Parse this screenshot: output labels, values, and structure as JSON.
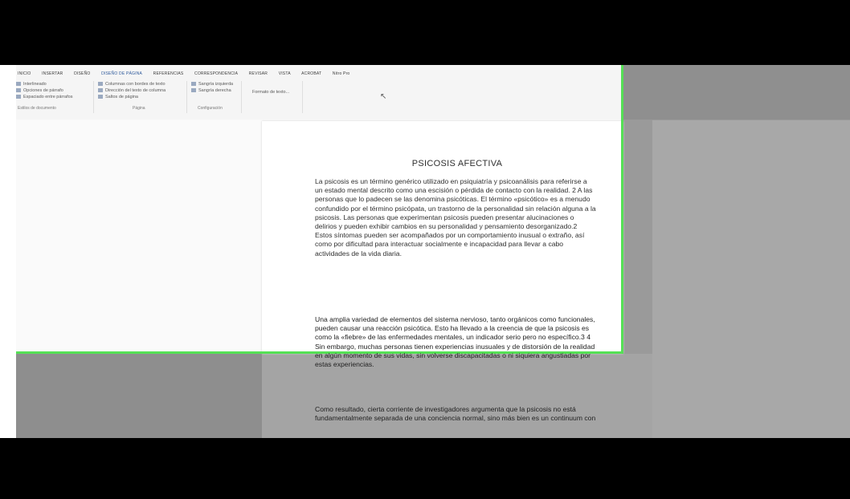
{
  "ribbon": {
    "tabs": [
      "INICIO",
      "INSERTAR",
      "DISEÑO",
      "DISEÑO DE PÁGINA",
      "REFERENCIAS",
      "CORRESPONDENCIA",
      "REVISAR",
      "VISTA",
      "ACROBAT",
      "Nitro Pro"
    ],
    "groups": {
      "g1": {
        "items": [
          "Interlineado",
          "Opciones de párrafo",
          "Espaciado entre párrafos"
        ],
        "label": "Estilos de documento"
      },
      "g2": {
        "items": [
          "Columnas con bordes de texto",
          "Dirección del texto de columna",
          "Saltos de página"
        ],
        "label": "Página"
      },
      "g3": {
        "items": [
          "Sangría izquierda",
          "Sangría derecha"
        ],
        "label": "Configuración"
      },
      "g4": {
        "items": [
          "Formato de texto..."
        ]
      }
    }
  },
  "document": {
    "title": "PSICOSIS AFECTIVA",
    "paragraphs": [
      "La psicosis es un término genérico utilizado en psiquiatría y psicoanálisis para referirse a un estado mental descrito como una escisión o pérdida de contacto con la realidad. 2 A las personas que lo padecen se las denomina psicóticas. El término «psicótico» es a menudo confundido por el término psicópata, un trastorno de la personalidad sin relación alguna a la psicosis. Las personas que experimentan psicosis pueden presentar alucinaciones o delirios y pueden exhibir cambios en su personalidad y pensamiento desorganizado.2 Estos síntomas pueden ser acompañados por un comportamiento inusual o extraño, así como por dificultad para interactuar socialmente e incapacidad para llevar a cabo actividades de la vida diaria.",
      "Una amplia variedad de elementos del sistema nervioso, tanto orgánicos como funcionales, pueden causar una reacción psicótica. Esto ha llevado a la creencia de que la psicosis es como la «fiebre» de las enfermedades mentales, un indicador serio pero no específico.3 4 Sin embargo, muchas personas tienen experiencias inusuales y de distorsión de la realidad en algún momento de sus vidas, sin volverse discapacitadas o ni siquiera angustiadas por estas experiencias.",
      "Como resultado, cierta corriente de investigadores argumenta que la psicosis no está fundamentalmente separada de una conciencia normal, sino más bien es un continuum con"
    ]
  }
}
